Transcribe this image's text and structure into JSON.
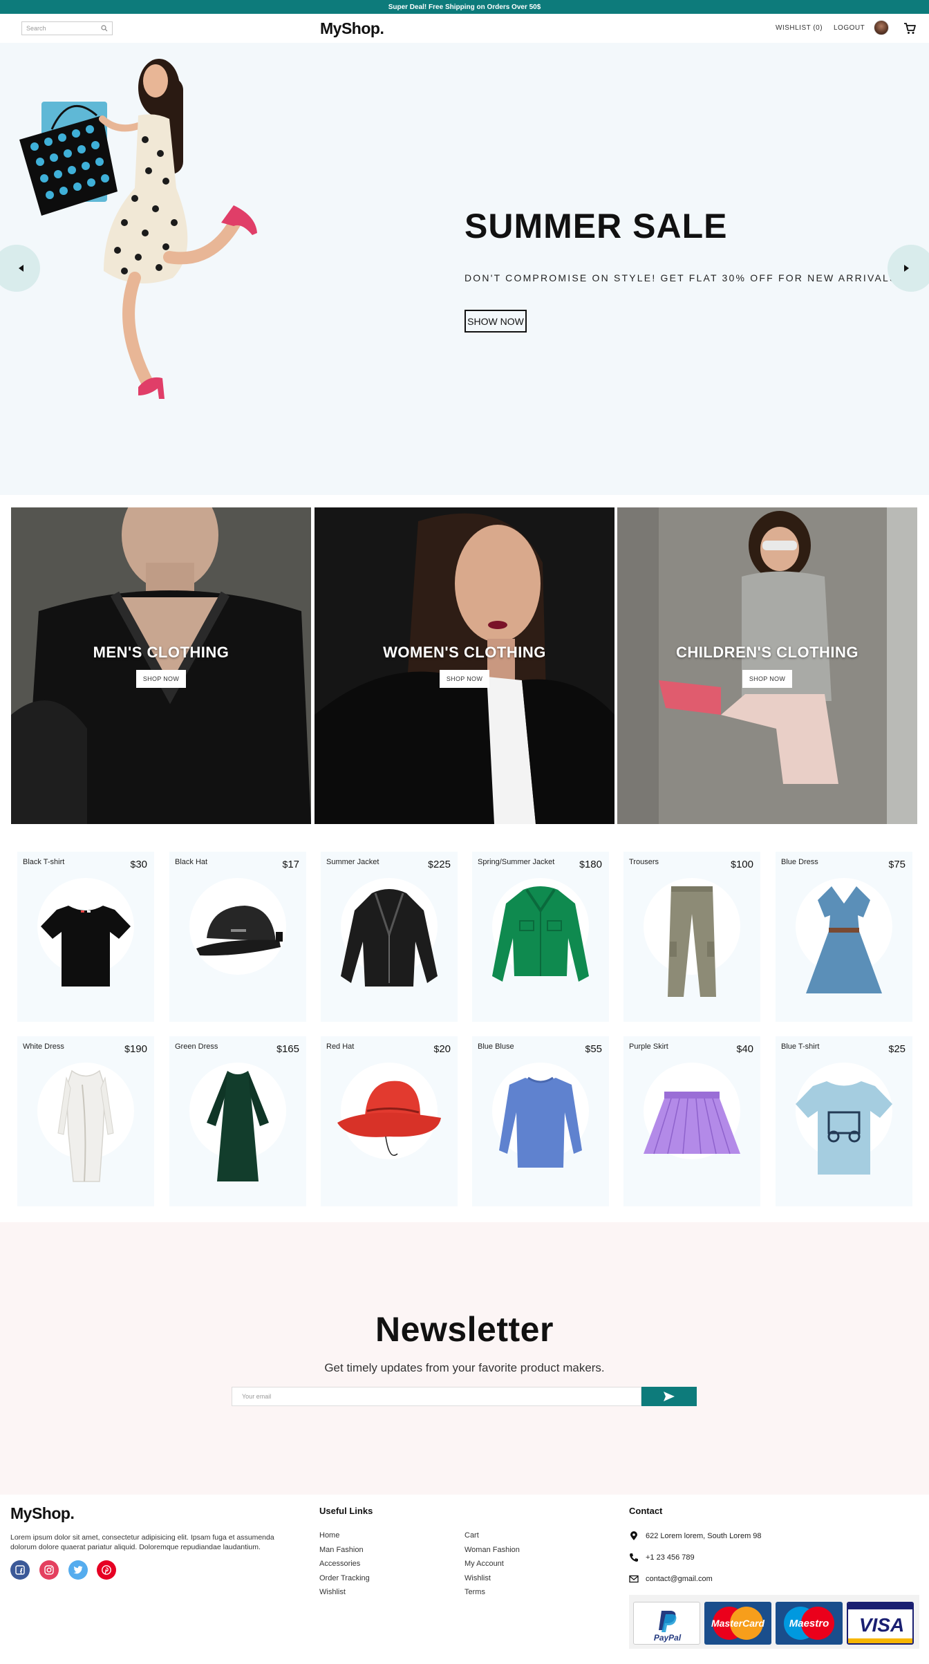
{
  "announcement": "Super Deal! Free Shipping on Orders Over 50$",
  "header": {
    "search_placeholder": "Search",
    "logo": "MyShop.",
    "wishlist": "WISHLIST (0)",
    "logout": "LOGOUT"
  },
  "hero": {
    "title": "SUMMER SALE",
    "subtitle": "DON'T COMPROMISE ON STYLE! GET FLAT 30% OFF FOR NEW ARRIVALS.",
    "button": "SHOW NOW"
  },
  "categories": [
    {
      "title": "MEN'S CLOTHING",
      "button": "SHOP NOW"
    },
    {
      "title": "WOMEN'S CLOTHING",
      "button": "SHOP NOW"
    },
    {
      "title": "CHILDREN'S CLOTHING",
      "button": "SHOP NOW"
    }
  ],
  "products": [
    {
      "name": "Black T-shirt",
      "currency": "$",
      "price": "30"
    },
    {
      "name": "Black Hat",
      "currency": "$",
      "price": "17"
    },
    {
      "name": "Summer Jacket",
      "currency": "$",
      "price": "225"
    },
    {
      "name": "Spring/Summer Jacket",
      "currency": "$",
      "price": "180"
    },
    {
      "name": "Trousers",
      "currency": "$",
      "price": "100"
    },
    {
      "name": "Blue Dress",
      "currency": "$",
      "price": "75"
    },
    {
      "name": "White Dress",
      "currency": "$",
      "price": "190"
    },
    {
      "name": "Green Dress",
      "currency": "$",
      "price": "165"
    },
    {
      "name": "Red Hat",
      "currency": "$",
      "price": "20"
    },
    {
      "name": "Blue Bluse",
      "currency": "$",
      "price": "55"
    },
    {
      "name": "Purple Skirt",
      "currency": "$",
      "price": "40"
    },
    {
      "name": "Blue T-shirt",
      "currency": "$",
      "price": "25"
    }
  ],
  "newsletter": {
    "title": "Newsletter",
    "description": "Get timely updates from your favorite product makers.",
    "placeholder": "Your email"
  },
  "footer": {
    "logo": "MyShop.",
    "description": "Lorem ipsum dolor sit amet, consectetur adipisicing elit. Ipsam fuga et assumenda dolorum dolore quaerat pariatur aliquid. Doloremque repudiandae laudantium.",
    "useful_links_title": "Useful Links",
    "links_col1": [
      "Home",
      "Man Fashion",
      "Accessories",
      "Order Tracking",
      "Wishlist"
    ],
    "links_col2": [
      "Cart",
      "Woman Fashion",
      "My Account",
      "Wishlist",
      "Terms"
    ],
    "contact_title": "Contact",
    "address": "622 Lorem lorem, South Lorem 98",
    "phone": "+1 23 456 789",
    "email": "contact@gmail.com",
    "payments": [
      "PayPal",
      "MasterCard",
      "Maestro",
      "VISA"
    ]
  },
  "colors": {
    "accent": "#0d7b7b",
    "hero_bg": "#f3f8fb",
    "product_bg": "#f5fafd",
    "newsletter_bg": "#fcf5f5"
  }
}
